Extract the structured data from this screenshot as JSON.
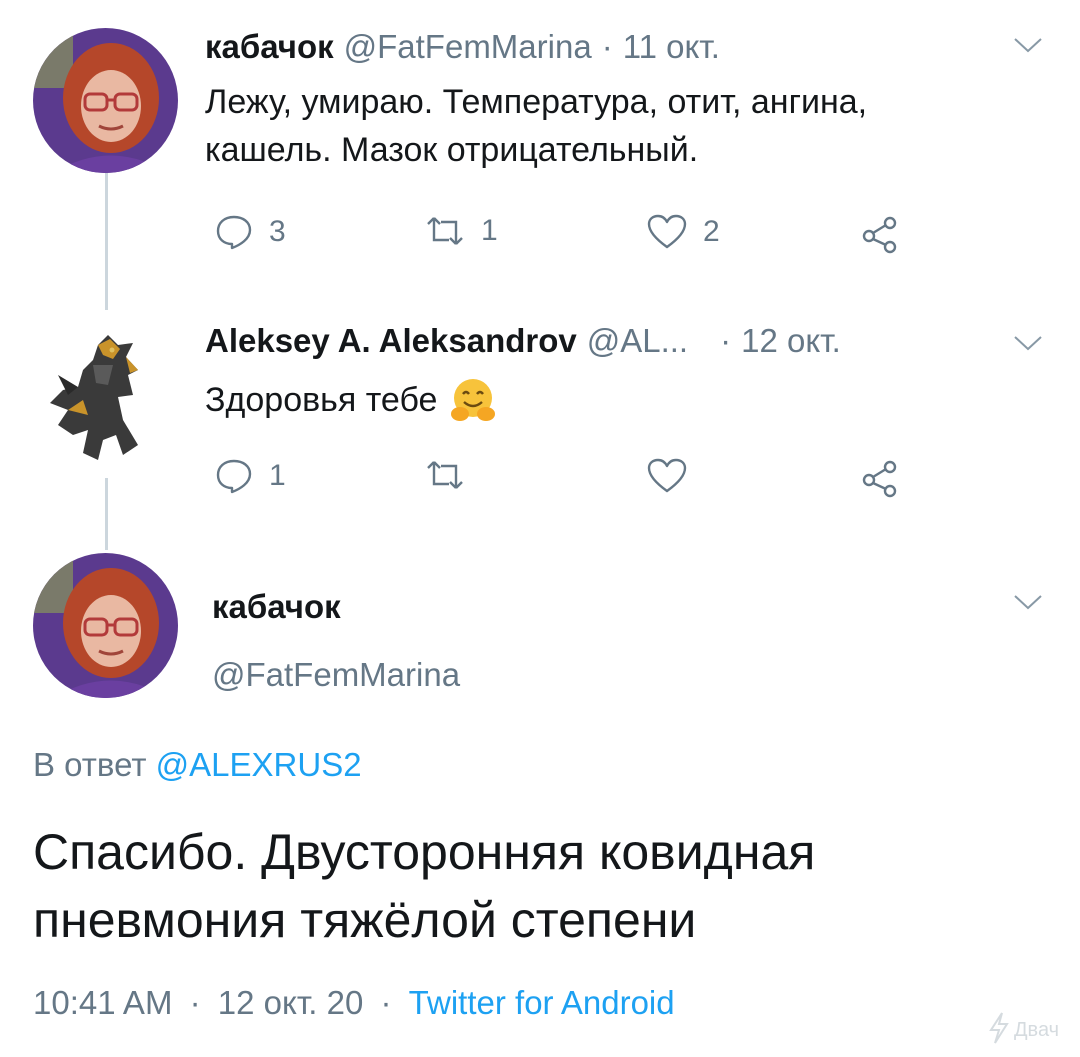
{
  "tweets": [
    {
      "author": "кабачок",
      "handle": "@FatFemMarina",
      "date": "11 окт.",
      "text_lines": [
        "Лежу, умираю. Температура, отит, ангина,",
        "кашель. Мазок отрицательный."
      ],
      "reply_count": "3",
      "retweet_count": "1",
      "like_count": "2"
    },
    {
      "author": "Aleksey A. Aleksandrov",
      "handle": "@AL...",
      "date": "12 окт.",
      "text": "Здоровья тебе",
      "emoji": "🤗",
      "reply_count": "1"
    }
  ],
  "main_tweet": {
    "author": "кабачок",
    "handle": "@FatFemMarina",
    "reply_prefix": "В ответ",
    "reply_to": "@ALEXRUS2",
    "text_lines": [
      "Спасибо. Двусторонняя ковидная",
      "пневмония тяжёлой степени"
    ],
    "time": "10:41 AM",
    "separator": "·",
    "date": "12 окт. 20",
    "source": "Twitter for Android"
  },
  "watermark": "Двач",
  "colors": {
    "text": "#14171a",
    "muted": "#657786",
    "link": "#1da1f2",
    "thread_line": "#ccd6dd",
    "avatar_bg": "#5b3a8e",
    "hair": "#b5472a"
  }
}
